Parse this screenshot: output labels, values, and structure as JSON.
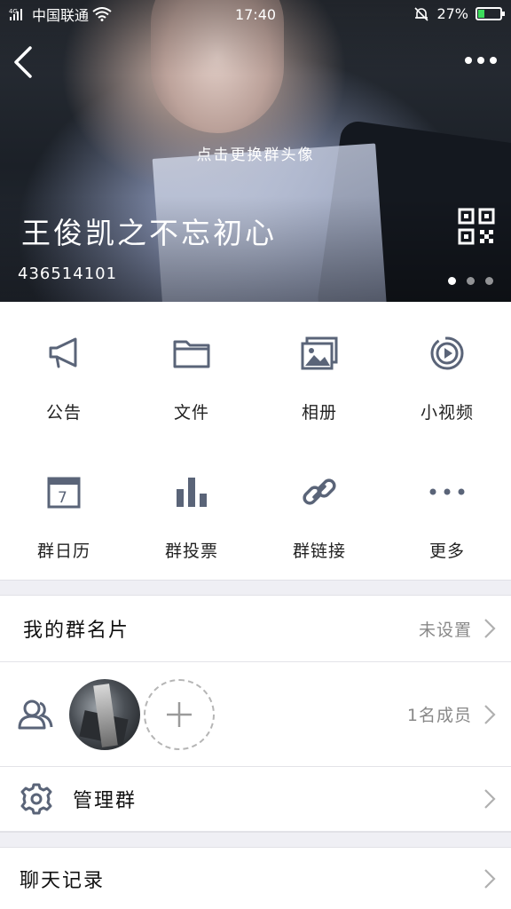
{
  "status_bar": {
    "carrier": "中国联通",
    "time": "17:40",
    "battery": "27%",
    "battery_level": 0.27
  },
  "header": {
    "cover_hint": "点击更换群头像",
    "group_name": "王俊凯之不忘初心",
    "group_id": "436514101",
    "page_dots": 3,
    "active_dot": 0
  },
  "features": [
    {
      "label": "公告",
      "icon": "megaphone-icon"
    },
    {
      "label": "文件",
      "icon": "folder-icon"
    },
    {
      "label": "相册",
      "icon": "album-icon"
    },
    {
      "label": "小视频",
      "icon": "video-icon"
    },
    {
      "label": "群日历",
      "icon": "calendar-icon"
    },
    {
      "label": "群投票",
      "icon": "bar-chart-icon"
    },
    {
      "label": "群链接",
      "icon": "link-icon"
    },
    {
      "label": "更多",
      "icon": "more-dots-icon"
    }
  ],
  "rows": {
    "card": {
      "title": "我的群名片",
      "value": "未设置"
    },
    "members": {
      "value": "1名成员"
    },
    "manage": {
      "title": "管理群"
    },
    "chat": {
      "title": "聊天记录"
    }
  },
  "colors": {
    "icon": "#5a6478",
    "divider": "#e3e3e8",
    "gap": "#efeff4",
    "muted_text": "#888888"
  }
}
